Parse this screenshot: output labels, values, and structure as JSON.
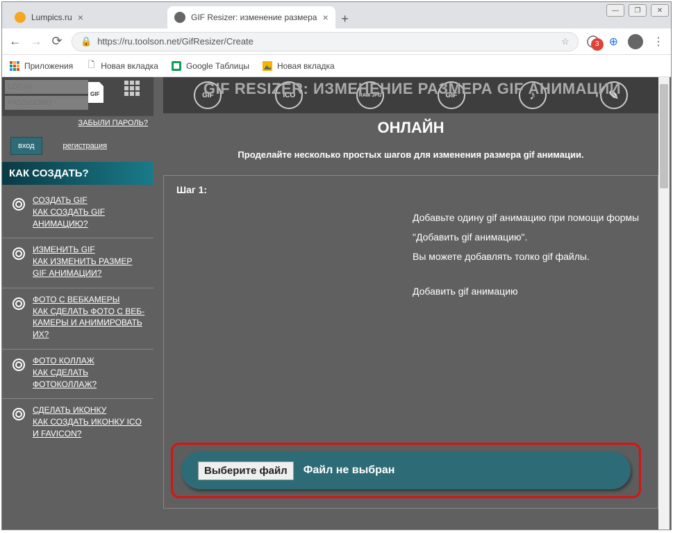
{
  "window": {
    "min": "—",
    "max": "❐",
    "close": "✕"
  },
  "tabs": [
    {
      "title": "Lumpics.ru",
      "fav_color": "#f5a623"
    },
    {
      "title": "GIF Resizer: изменение размера",
      "fav_color": "#666"
    }
  ],
  "url": "https://ru.toolson.net/GifResizer/Create",
  "ext_badge": "3",
  "bookmarks": [
    {
      "label": "Приложения",
      "kind": "apps"
    },
    {
      "label": "Новая вкладка",
      "kind": "page"
    },
    {
      "label": "Google Таблицы",
      "kind": "sheets"
    },
    {
      "label": "Новая вкладка",
      "kind": "img"
    }
  ],
  "login": {
    "login_ph": "LOGIN",
    "pass_ph": "PASSWORD",
    "forgot": "ЗАБЫЛИ ПАРОЛЬ?",
    "enter": "вход",
    "reg": "регистрация"
  },
  "sidebar": {
    "header": "КАК СОЗДАТЬ?",
    "items": [
      {
        "t1": "СОЗДАТЬ GIF",
        "t2": "КАК СОЗДАТЬ GIF АНИМАЦИЮ?"
      },
      {
        "t1": "ИЗМЕНИТЬ GIF",
        "t2": "КАК ИЗМЕНИТЬ РАЗМЕР GIF АНИМАЦИИ?"
      },
      {
        "t1": "ФОТО С ВЕБКАМЕРЫ",
        "t2": "КАК СДЕЛАТЬ ФОТО С ВЕБ-КАМЕРЫ И АНИМИРОВАТЬ ИХ?"
      },
      {
        "t1": "ФОТО КОЛЛАЖ",
        "t2": "КАК СДЕЛАТЬ ФОТОКОЛЛАЖ?"
      },
      {
        "t1": "СДЕЛАТЬ ИКОНКУ",
        "t2": "КАК СОЗДАТЬ ИКОНКУ ICO И FAVICON?"
      }
    ]
  },
  "toolbar_icons": [
    "GIF",
    "ICO",
    "RAW JPG",
    "GIF",
    "♪",
    "✎"
  ],
  "page": {
    "bg_title": "GIF RESIZER: ИЗМЕНЕНИЕ РАЗМЕРА GIF АНИМАЦИИ",
    "title2": "ОНЛАЙН",
    "subtitle": "Проделайте несколько простых шагов для изменения размера gif анимации.",
    "step_h": "Шаг 1:",
    "step_p1": "Добавьте одину gif анимацию при помощи формы \"Добавить gif анимацию\".",
    "step_p2": "Вы можете добавлять толко gif файлы.",
    "step_p3": "Добавить gif анимацию",
    "choose": "Выберите файл",
    "nofile": "Файл не выбран"
  }
}
